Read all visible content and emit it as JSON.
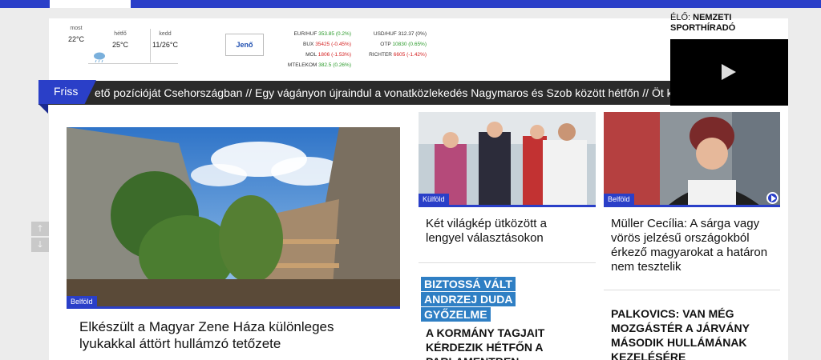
{
  "weather": {
    "days": [
      {
        "day": "most",
        "temp": "22°C"
      },
      {
        "day": "hétfő",
        "temp": "25°C"
      },
      {
        "day": "kedd",
        "temp": "11/26°C"
      }
    ],
    "icon": "cloud-rain-icon"
  },
  "name_button": "Jenő",
  "markets": {
    "col1": [
      {
        "name": "EUR/HUF",
        "value": "353.85 (0.2%)",
        "trend": "up"
      },
      {
        "name": "BUX",
        "value": "35425 (-0.45%)",
        "trend": "down"
      },
      {
        "name": "MOL",
        "value": "1806 (-1.53%)",
        "trend": "down"
      },
      {
        "name": "MTELEKOM",
        "value": "382.5 (0.26%)",
        "trend": "up"
      }
    ],
    "col2": [
      {
        "name": "USD/HUF",
        "value": "312.37 (0%)",
        "trend": "flat"
      },
      {
        "name": "OTP",
        "value": "10830 (0.65%)",
        "trend": "up"
      },
      {
        "name": "RICHTER",
        "value": "6605 (-1.42%)",
        "trend": "down"
      }
    ]
  },
  "live": {
    "label": "ÉLŐ:",
    "channel": "NEMZETI SPORTHÍRADÓ"
  },
  "ticker": {
    "label": "Friss",
    "text": "ető pozícióját Csehországban // Egy vágányon újraindul a vonatközlekedés Nagymaros és Szob között hétfőn // Öt kis"
  },
  "nav_arrows": {
    "up": "🡑",
    "down": "🡓"
  },
  "articles": {
    "main": {
      "tag": "Belföld",
      "title": "Elkészült a Magyar Zene Háza különleges lyukakkal áttört hullámzó tetőzete"
    },
    "mid": {
      "tag": "Külföld",
      "title": "Két világkép ütközött a lengyel választásokon"
    },
    "right": {
      "tag": "Belföld",
      "title": "Müller Cecília: A sárga vagy vörös jelzésű országokból érkező magyarokat a határon nem tesztelik"
    },
    "mid_highlight": "BIZTOSSÁ VÁLT ANDRZEJ DUDA GYŐZELME",
    "mid_upper": "A KORMÁNY TAGJAIT KÉRDEZIK HÉTFŐN A PARLAMENTBEN",
    "right_upper": "PALKOVICS: VAN MÉG MOZGÁSTÉR A JÁRVÁNY MÁSODIK HULLÁMÁNAK KEZELÉSÉRE"
  },
  "colors": {
    "brand_blue": "#2a3fc8",
    "highlight_blue": "#2f7fc4",
    "ticker_bg": "#2b2b2b",
    "up": "#2a9a2a",
    "down": "#d42020"
  }
}
